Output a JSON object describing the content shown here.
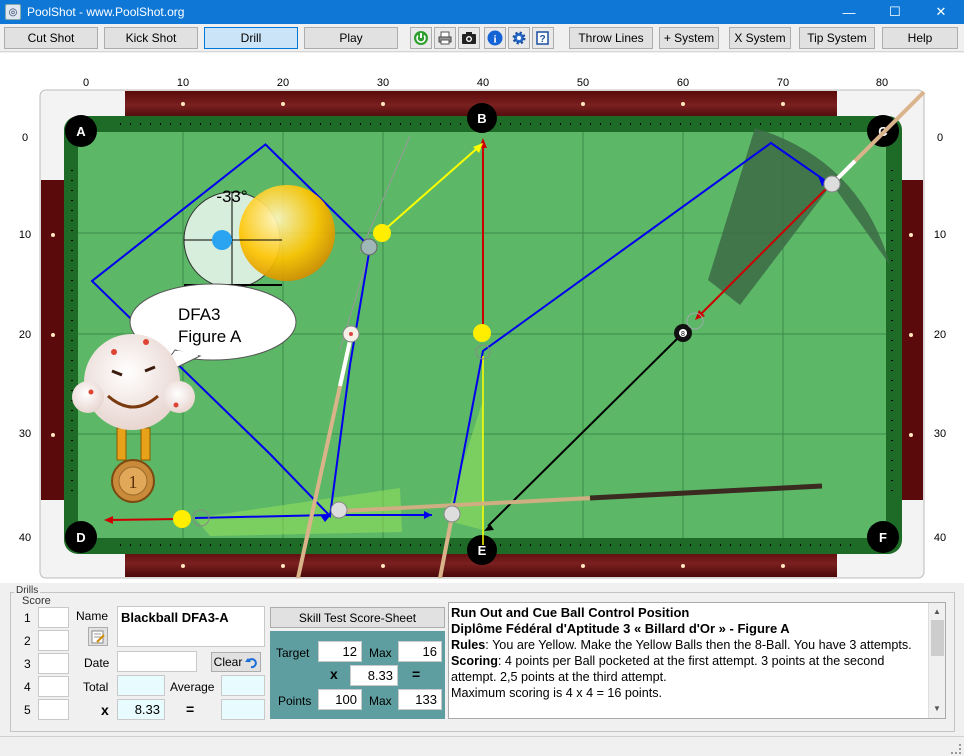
{
  "window": {
    "title": "PoolShot - www.PoolShot.org",
    "app_icon": "poolshot-icon",
    "controls": [
      "—",
      "☐",
      "✕"
    ]
  },
  "toolbar": {
    "cut_shot": "Cut Shot",
    "kick_shot": "Kick Shot",
    "drill": "Drill",
    "play": "Play",
    "icons": [
      "power-icon",
      "print-icon",
      "camera-icon",
      "info-icon",
      "settings-icon",
      "help-book-icon"
    ],
    "throw_lines": "Throw Lines",
    "plus_system": "+ System",
    "x_system": "X System",
    "tip_system": "Tip System",
    "help": "Help"
  },
  "table": {
    "x_ticks": [
      "0",
      "10",
      "20",
      "30",
      "40",
      "50",
      "60",
      "70",
      "80"
    ],
    "y_ticks": [
      "0",
      "10",
      "20",
      "30",
      "40"
    ],
    "pockets": [
      "A",
      "B",
      "C",
      "D",
      "E",
      "F"
    ],
    "cut_angle": "-33°",
    "bubble_line1": "DFA3",
    "bubble_line2": "Figure A",
    "medal": "1",
    "eight_ball": "8",
    "colors": {
      "felt": "#5cb867",
      "rail": "#1f6f2a",
      "yellow_ball": "#ffee00",
      "aim_line": "#0000ff",
      "cue_line": "#cc0000"
    }
  },
  "drills_panel": {
    "group_label": "Drills",
    "score_label": "Score",
    "rows": [
      "1",
      "2",
      "3",
      "4",
      "5"
    ],
    "name_label": "Name",
    "name_value": "Blackball DFA3-A",
    "date_label": "Date",
    "clear_label": "Clear",
    "total_label": "Total",
    "average_label": "Average",
    "x_symbol": "x",
    "multiplier": "8.33",
    "eq_symbol": "=",
    "skill_btn": "Skill Test Score-Sheet",
    "target_label": "Target",
    "target_value": "12",
    "max_label": "Max",
    "max_value": "16",
    "points_label": "Points",
    "points_value": "100",
    "points_max_label": "Max",
    "points_max_value": "133"
  },
  "description": {
    "title1": "Run Out and Cue Ball Control Position",
    "title2": "Diplôme Fédéral d'Aptitude 3 « Billard d'Or » - Figure A",
    "rules_label": "Rules",
    "rules_text": ": You are Yellow. Make the Yellow Balls then the 8-Ball. You have 3 attempts.",
    "scoring_label": "Scoring",
    "scoring_text": ": 4 points per Ball pocketed at the first attempt. 3 points at the second attempt. 2,5 points at the third attempt.",
    "max_text": "Maximum scoring is 4 x 4 = 16 points."
  }
}
